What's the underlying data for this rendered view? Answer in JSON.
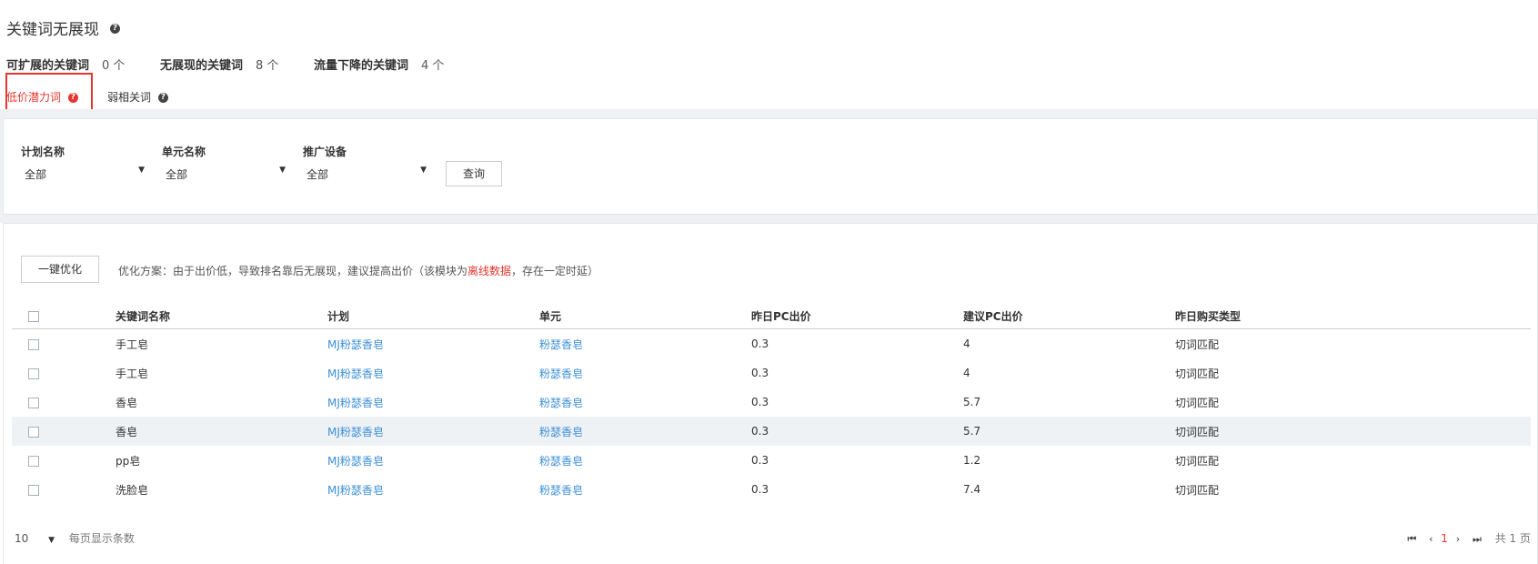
{
  "page": {
    "title": "关键词无展现"
  },
  "stats": [
    {
      "label": "可扩展的关键词",
      "value": "0 个"
    },
    {
      "label": "无展现的关键词",
      "value": "8 个"
    },
    {
      "label": "流量下降的关键词",
      "value": "4 个"
    }
  ],
  "tabs": {
    "low_price": "低价潜力词",
    "weak": "弱相关词"
  },
  "filters": {
    "plan_label": "计划名称",
    "plan_value": "全部",
    "unit_label": "单元名称",
    "unit_value": "全部",
    "device_label": "推广设备",
    "device_value": "全部",
    "query_button": "查询"
  },
  "optimize": {
    "button": "一键优化",
    "text_prefix": "优化方案：由于出价低，导致排名靠后无展现，建议提高出价（该模块为",
    "text_highlight": "离线数据",
    "text_suffix": "，存在一定时延）"
  },
  "table": {
    "headers": [
      "关键词名称",
      "计划",
      "单元",
      "昨日PC出价",
      "建议PC出价",
      "昨日购买类型"
    ],
    "rows": [
      {
        "keyword": "手工皂",
        "plan": "MJ粉瑟香皂",
        "unit": "粉瑟香皂",
        "yesterday_bid": "0.3",
        "suggested_bid": "4",
        "match_type": "切词匹配"
      },
      {
        "keyword": "手工皂",
        "plan": "MJ粉瑟香皂",
        "unit": "粉瑟香皂",
        "yesterday_bid": "0.3",
        "suggested_bid": "4",
        "match_type": "切词匹配"
      },
      {
        "keyword": "香皂",
        "plan": "MJ粉瑟香皂",
        "unit": "粉瑟香皂",
        "yesterday_bid": "0.3",
        "suggested_bid": "5.7",
        "match_type": "切词匹配"
      },
      {
        "keyword": "香皂",
        "plan": "MJ粉瑟香皂",
        "unit": "粉瑟香皂",
        "yesterday_bid": "0.3",
        "suggested_bid": "5.7",
        "match_type": "切词匹配"
      },
      {
        "keyword": "pp皂",
        "plan": "MJ粉瑟香皂",
        "unit": "粉瑟香皂",
        "yesterday_bid": "0.3",
        "suggested_bid": "1.2",
        "match_type": "切词匹配"
      },
      {
        "keyword": "洗脸皂",
        "plan": "MJ粉瑟香皂",
        "unit": "粉瑟香皂",
        "yesterday_bid": "0.3",
        "suggested_bid": "7.4",
        "match_type": "切词匹配"
      }
    ]
  },
  "pagination": {
    "page_size": "10",
    "page_size_label": "每页显示条数",
    "current_page": "1",
    "total_label": "共 1 页"
  },
  "colors": {
    "accent": "#e5352e",
    "link": "#3c8fd6",
    "band": "#eef0f4"
  },
  "icons": [
    "help-icon",
    "first-page-icon",
    "prev-page-icon",
    "next-page-icon",
    "last-page-icon",
    "dropdown-arrow-icon"
  ]
}
